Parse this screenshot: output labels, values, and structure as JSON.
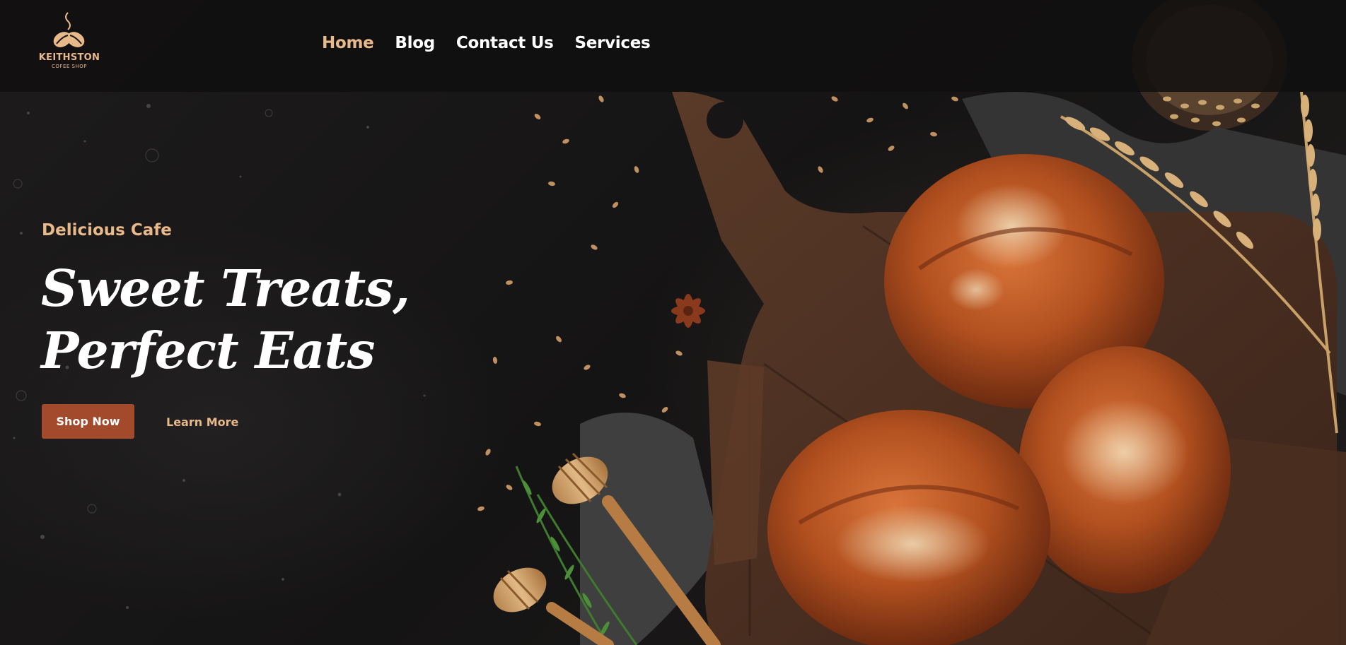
{
  "brand": {
    "name": "KEITHSTON",
    "tagline": "COFEE SHOP"
  },
  "nav": {
    "items": [
      {
        "label": "Home",
        "active": true
      },
      {
        "label": "Blog",
        "active": false
      },
      {
        "label": "Contact Us",
        "active": false
      },
      {
        "label": "Services",
        "active": false
      }
    ]
  },
  "hero": {
    "eyebrow": "Delicious Cafe",
    "headline_line1": "Sweet Treats,",
    "headline_line2": "Perfect Eats",
    "primary_button": "Shop Now",
    "secondary_button": "Learn More",
    "image_description_icon": "bread-rolls-on-cutting-board-image"
  },
  "colors": {
    "accent": "#e8b98a",
    "button": "#a44a2c",
    "header_bg": "#100f0f",
    "text": "#ffffff"
  }
}
